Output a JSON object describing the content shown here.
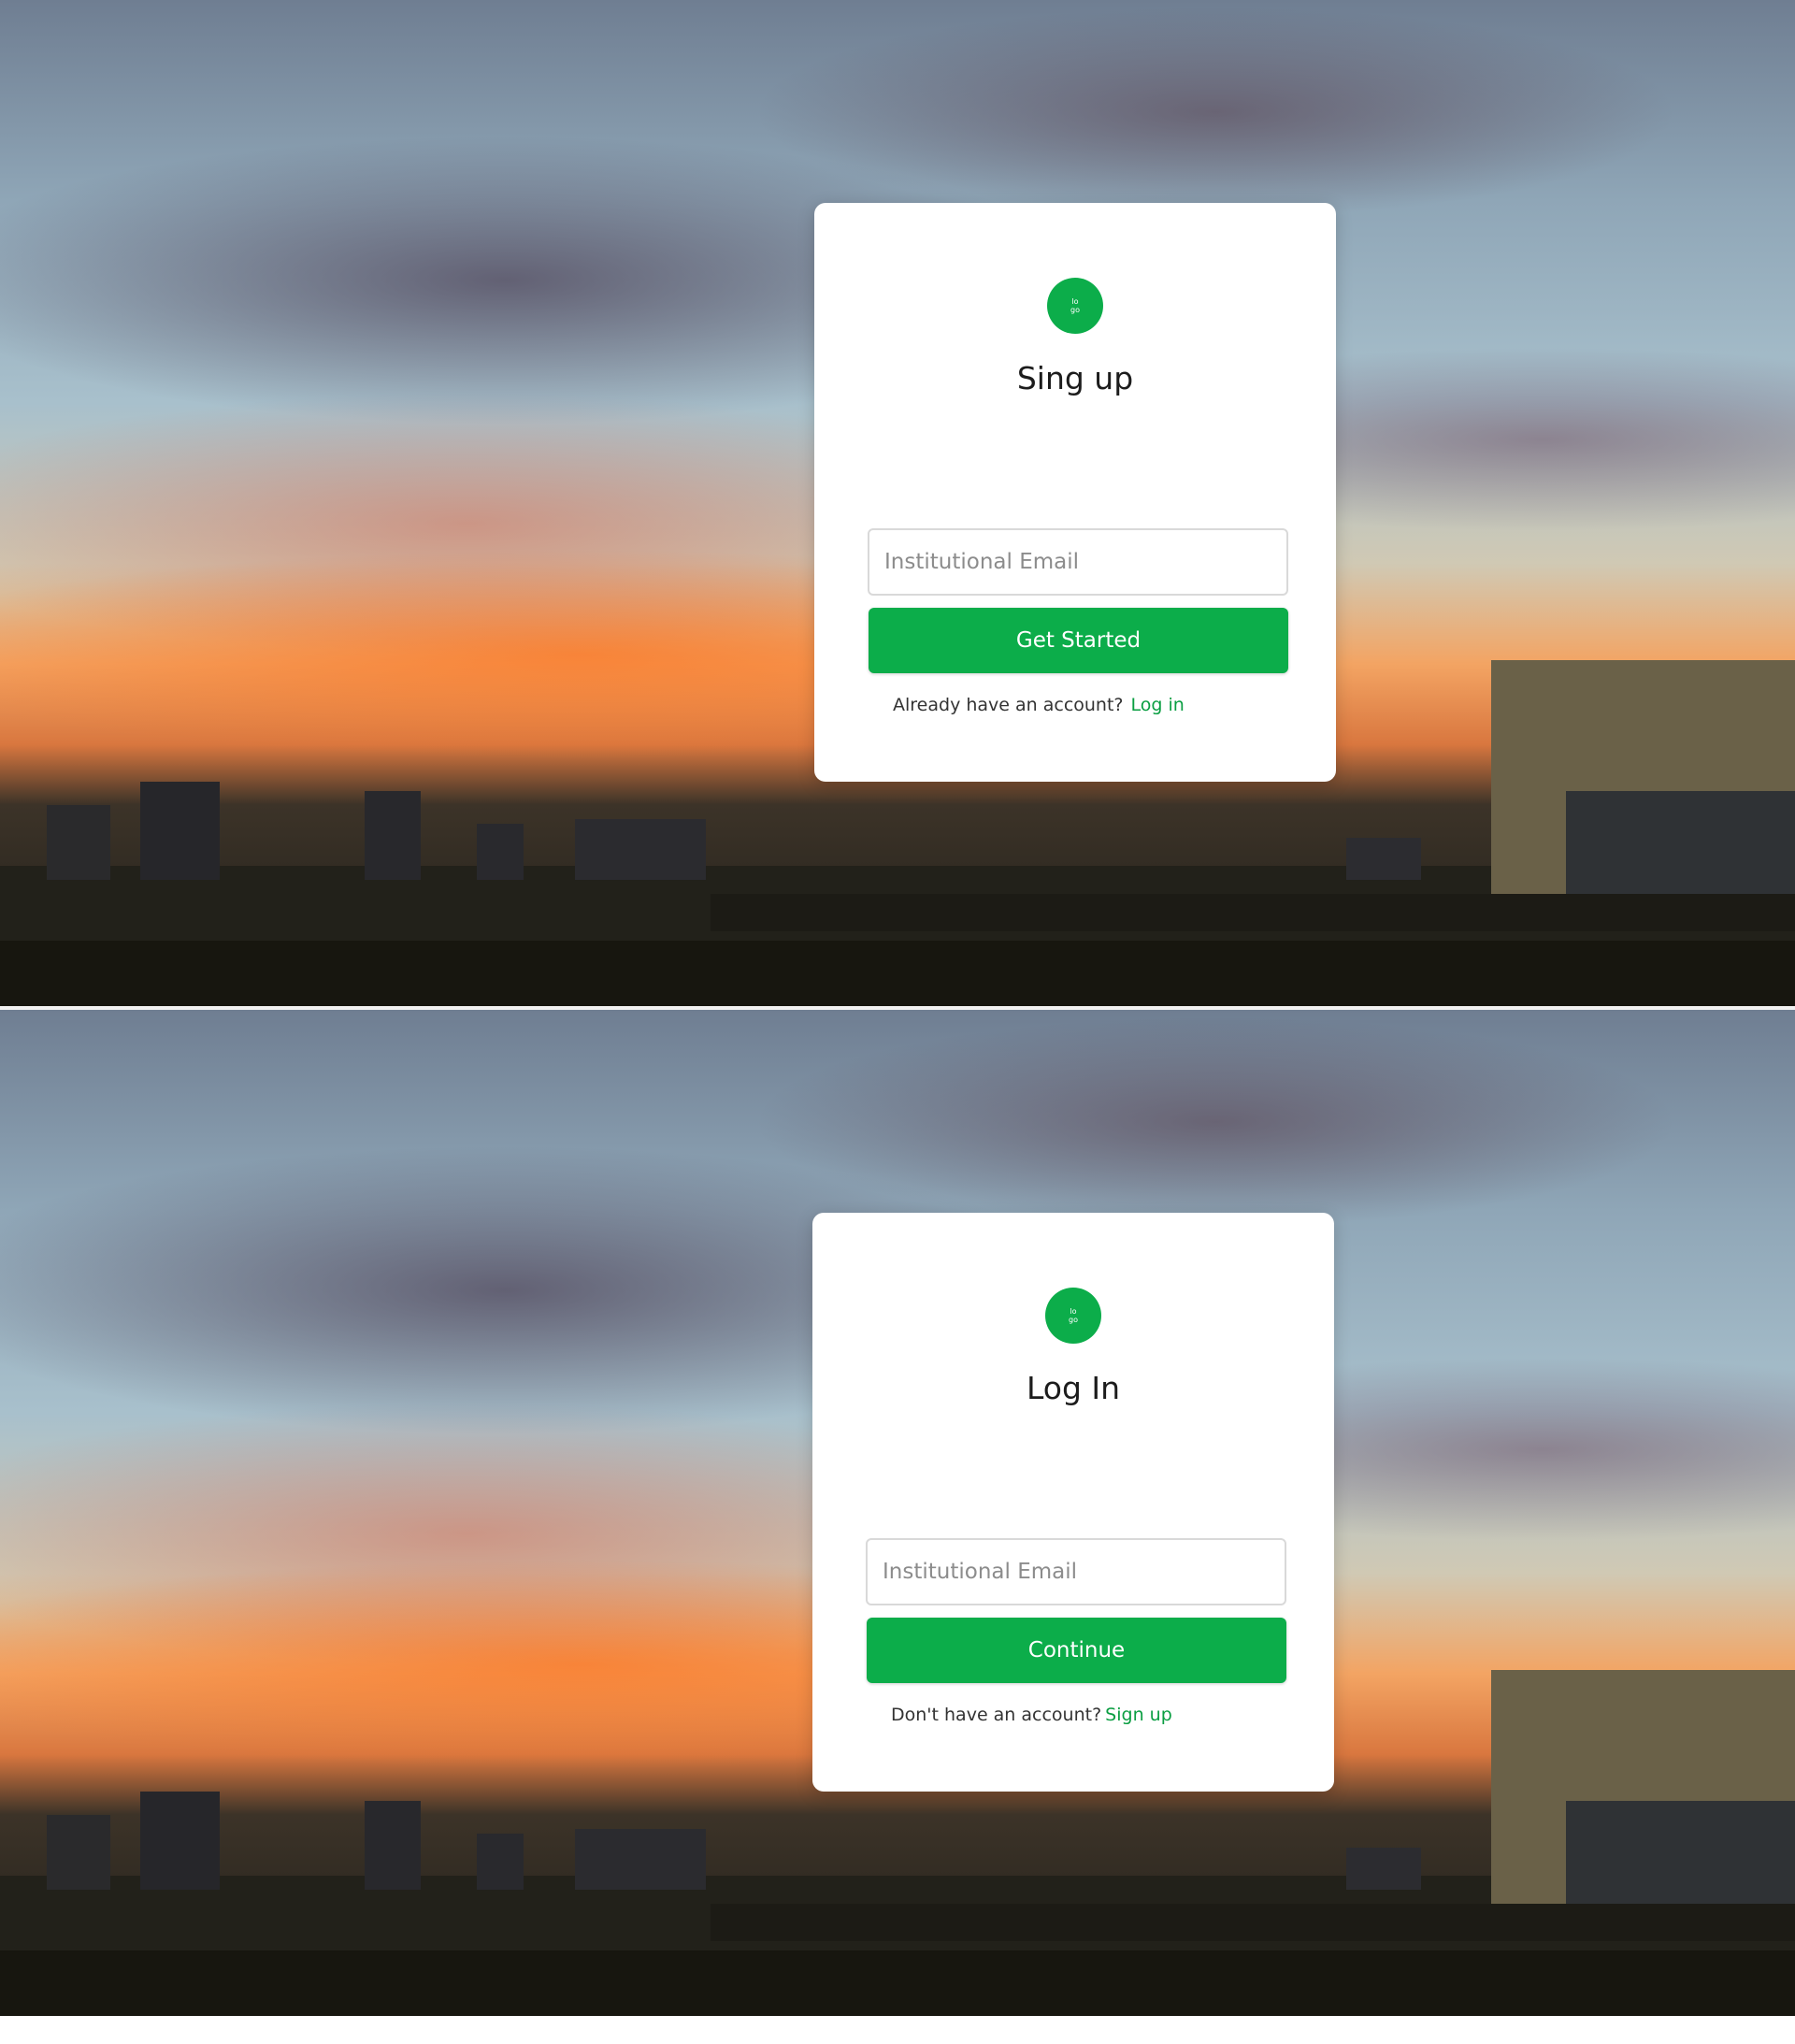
{
  "colors": {
    "accent": "#0cad4a",
    "link": "#0a9e42",
    "card": "#ffffff"
  },
  "signup": {
    "logo_text": "lo go",
    "title": "Sing up",
    "email_placeholder": "Institutional Email",
    "button_label": "Get Started",
    "prompt_text": "Already have an account?",
    "link_text": "Log in"
  },
  "login": {
    "logo_text": "lo go",
    "title": "Log In",
    "email_placeholder": "Institutional Email",
    "button_label": "Continue",
    "prompt_text": "Don't have an account?",
    "link_text": "Sign up"
  }
}
